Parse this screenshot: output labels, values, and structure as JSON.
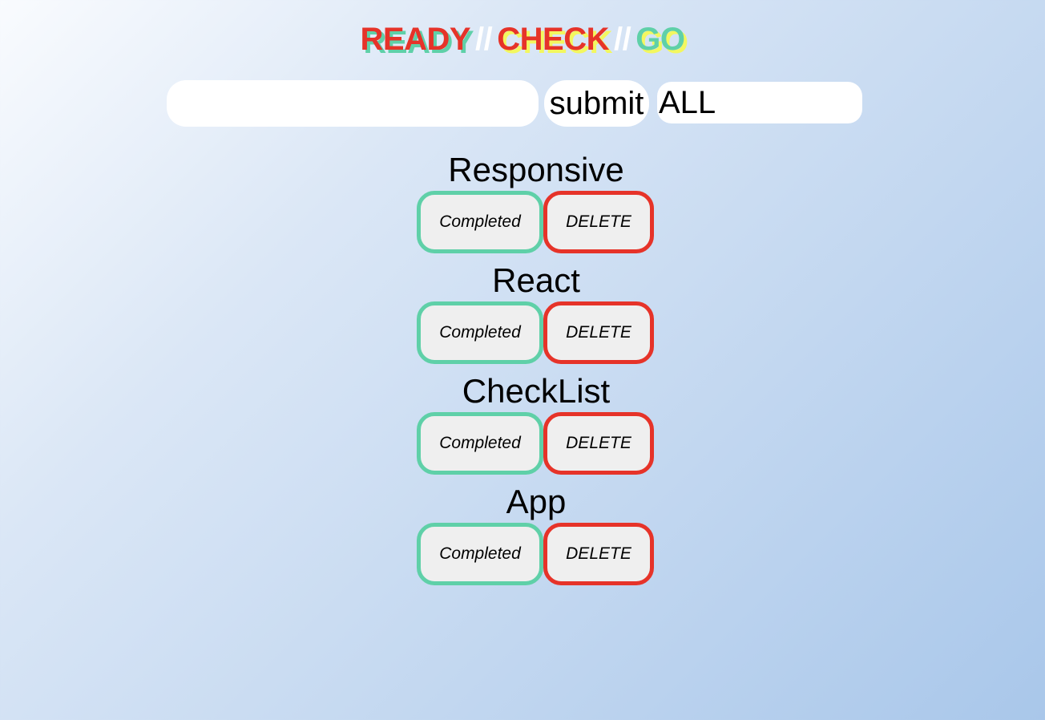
{
  "header": {
    "word_ready": "READY",
    "separator_1": "//",
    "word_check": "CHECK",
    "separator_2": "//",
    "word_go": "GO"
  },
  "form": {
    "input_value": "",
    "submit_label": "submit",
    "filter_selected": "ALL"
  },
  "todos": [
    {
      "text": "Responsive",
      "complete_label": "Completed",
      "delete_label": "DELETE"
    },
    {
      "text": "React",
      "complete_label": "Completed",
      "delete_label": "DELETE"
    },
    {
      "text": "CheckList",
      "complete_label": "Completed",
      "delete_label": "DELETE"
    },
    {
      "text": "App",
      "complete_label": "Completed",
      "delete_label": "DELETE"
    }
  ],
  "colors": {
    "accent_red": "#e63329",
    "accent_green": "#5fd0a8",
    "accent_yellow": "#f3f75f"
  }
}
